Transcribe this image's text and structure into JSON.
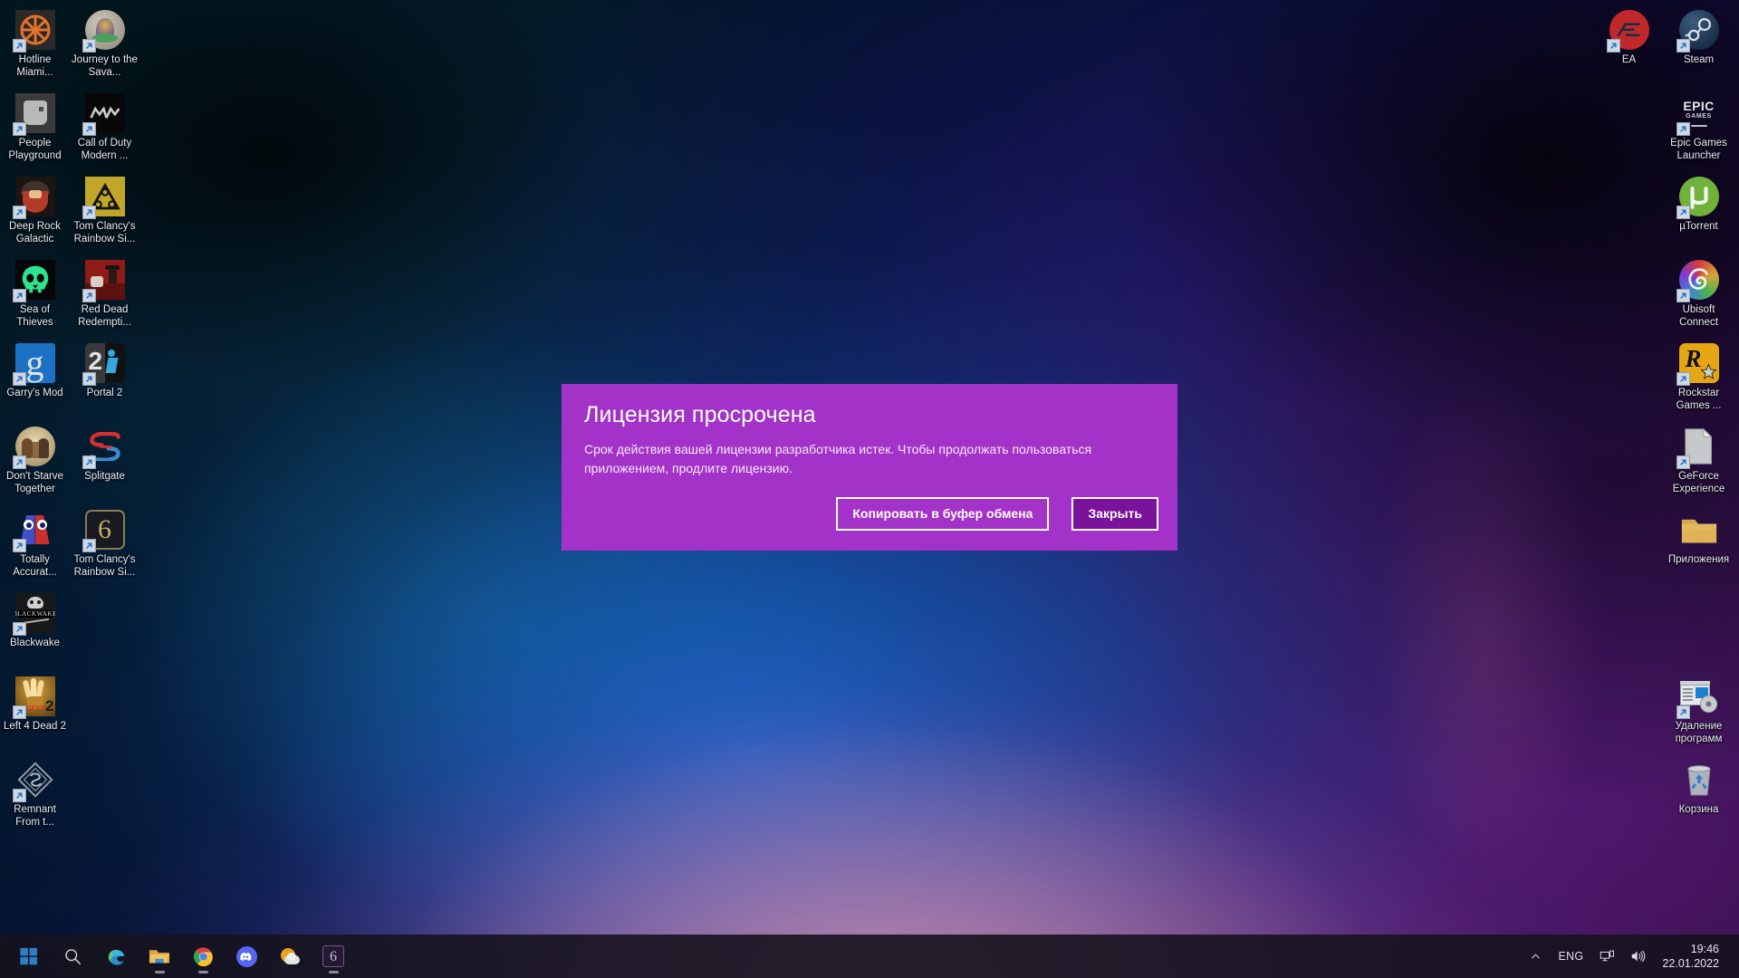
{
  "desktop": {
    "left_icons": [
      {
        "label": "Hotline Miami...",
        "icon": "hotline-miami-icon",
        "shortcut": true
      },
      {
        "label": "Journey to the Sava...",
        "icon": "journey-to-the-savage-planet-icon",
        "shortcut": true
      },
      {
        "label": "People Playground",
        "icon": "people-playground-icon",
        "shortcut": true
      },
      {
        "label": "Call of Duty Modern ...",
        "icon": "call-of-duty-modern-warfare-icon",
        "shortcut": true
      },
      {
        "label": "Deep Rock Galactic",
        "icon": "deep-rock-galactic-icon",
        "shortcut": true
      },
      {
        "label": "Tom Clancy's Rainbow Si...",
        "icon": "tom-clancys-rainbow-six-extraction-icon",
        "shortcut": true
      },
      {
        "label": "Sea of Thieves",
        "icon": "sea-of-thieves-icon",
        "shortcut": true
      },
      {
        "label": "Red Dead Redempti...",
        "icon": "red-dead-redemption-icon",
        "shortcut": true
      },
      {
        "label": "Garry's Mod",
        "icon": "garrys-mod-icon",
        "shortcut": true
      },
      {
        "label": "Portal 2",
        "icon": "portal-2-icon",
        "shortcut": true
      },
      {
        "label": "Don't Starve Together",
        "icon": "dont-starve-together-icon",
        "shortcut": true
      },
      {
        "label": "Splitgate",
        "icon": "splitgate-icon",
        "shortcut": true
      },
      {
        "label": "Totally Accurat...",
        "icon": "totally-accurate-battle-simulator-icon",
        "shortcut": true
      },
      {
        "label": "Tom Clancy's Rainbow Si...",
        "icon": "tom-clancys-rainbow-six-siege-icon",
        "shortcut": true
      },
      {
        "label": "Blackwake",
        "icon": "blackwake-icon",
        "shortcut": true
      },
      {
        "label": "",
        "icon": "empty-slot",
        "shortcut": false
      },
      {
        "label": "Left 4 Dead 2",
        "icon": "left-4-dead-2-icon",
        "shortcut": true
      },
      {
        "label": "",
        "icon": "empty-slot",
        "shortcut": false
      },
      {
        "label": "Remnant From t...",
        "icon": "remnant-from-the-ashes-icon",
        "shortcut": true
      }
    ],
    "right_icons": [
      {
        "label": "EA",
        "icon": "ea-app-icon",
        "shortcut": true
      },
      {
        "label": "Steam",
        "icon": "steam-icon",
        "shortcut": true
      },
      {
        "label": "",
        "icon": "empty-slot",
        "shortcut": false
      },
      {
        "label": "Epic Games Launcher",
        "icon": "epic-games-launcher-icon",
        "shortcut": true
      },
      {
        "label": "",
        "icon": "empty-slot",
        "shortcut": false
      },
      {
        "label": "µTorrent",
        "icon": "utorrent-icon",
        "shortcut": true
      },
      {
        "label": "",
        "icon": "empty-slot",
        "shortcut": false
      },
      {
        "label": "Ubisoft Connect",
        "icon": "ubisoft-connect-icon",
        "shortcut": true
      },
      {
        "label": "",
        "icon": "empty-slot",
        "shortcut": false
      },
      {
        "label": "Rockstar Games ...",
        "icon": "rockstar-games-launcher-icon",
        "shortcut": true
      },
      {
        "label": "",
        "icon": "empty-slot",
        "shortcut": false
      },
      {
        "label": "GeForce Experience",
        "icon": "geforce-experience-file-icon",
        "shortcut": true
      },
      {
        "label": "",
        "icon": "empty-slot",
        "shortcut": false
      },
      {
        "label": "Приложения",
        "icon": "folder-icon",
        "shortcut": false
      },
      {
        "label": "",
        "icon": "empty-slot",
        "shortcut": false
      },
      {
        "label": "",
        "icon": "empty-slot",
        "shortcut": false
      },
      {
        "label": "",
        "icon": "empty-slot",
        "shortcut": false
      },
      {
        "label": "Удаление программ",
        "icon": "uninstall-programs-icon",
        "shortcut": true
      },
      {
        "label": "",
        "icon": "empty-slot",
        "shortcut": false
      },
      {
        "label": "Корзина",
        "icon": "recycle-bin-icon",
        "shortcut": false
      }
    ]
  },
  "dialog": {
    "title": "Лицензия просрочена",
    "message": "Срок действия вашей лицензии разработчика истек. Чтобы продолжать пользоваться приложением, продлите лицензию.",
    "copy_button": "Копировать в буфер обмена",
    "close_button": "Закрыть",
    "background_color": "#a333c8",
    "primary_button_color": "#7a129b"
  },
  "taskbar": {
    "items": [
      {
        "name": "start-button",
        "icon": "windows-logo-icon",
        "running": false
      },
      {
        "name": "search-button",
        "icon": "search-icon",
        "running": false
      },
      {
        "name": "edge-button",
        "icon": "edge-icon",
        "running": false
      },
      {
        "name": "file-explorer-button",
        "icon": "folder-icon",
        "running": true
      },
      {
        "name": "chrome-button",
        "icon": "chrome-icon",
        "running": true
      },
      {
        "name": "discord-button",
        "icon": "discord-icon",
        "running": false
      },
      {
        "name": "weather-button",
        "icon": "weather-sun-cloud-icon",
        "running": false
      },
      {
        "name": "rainbow-six-button",
        "icon": "rainbow-six-siege-icon",
        "running": true
      }
    ],
    "tray": {
      "overflow_icon": "chevron-up-icon",
      "language": "ENG",
      "network_icon": "network-monitor-icon",
      "volume_icon": "speaker-icon",
      "time": "19:46",
      "date": "22.01.2022"
    }
  }
}
